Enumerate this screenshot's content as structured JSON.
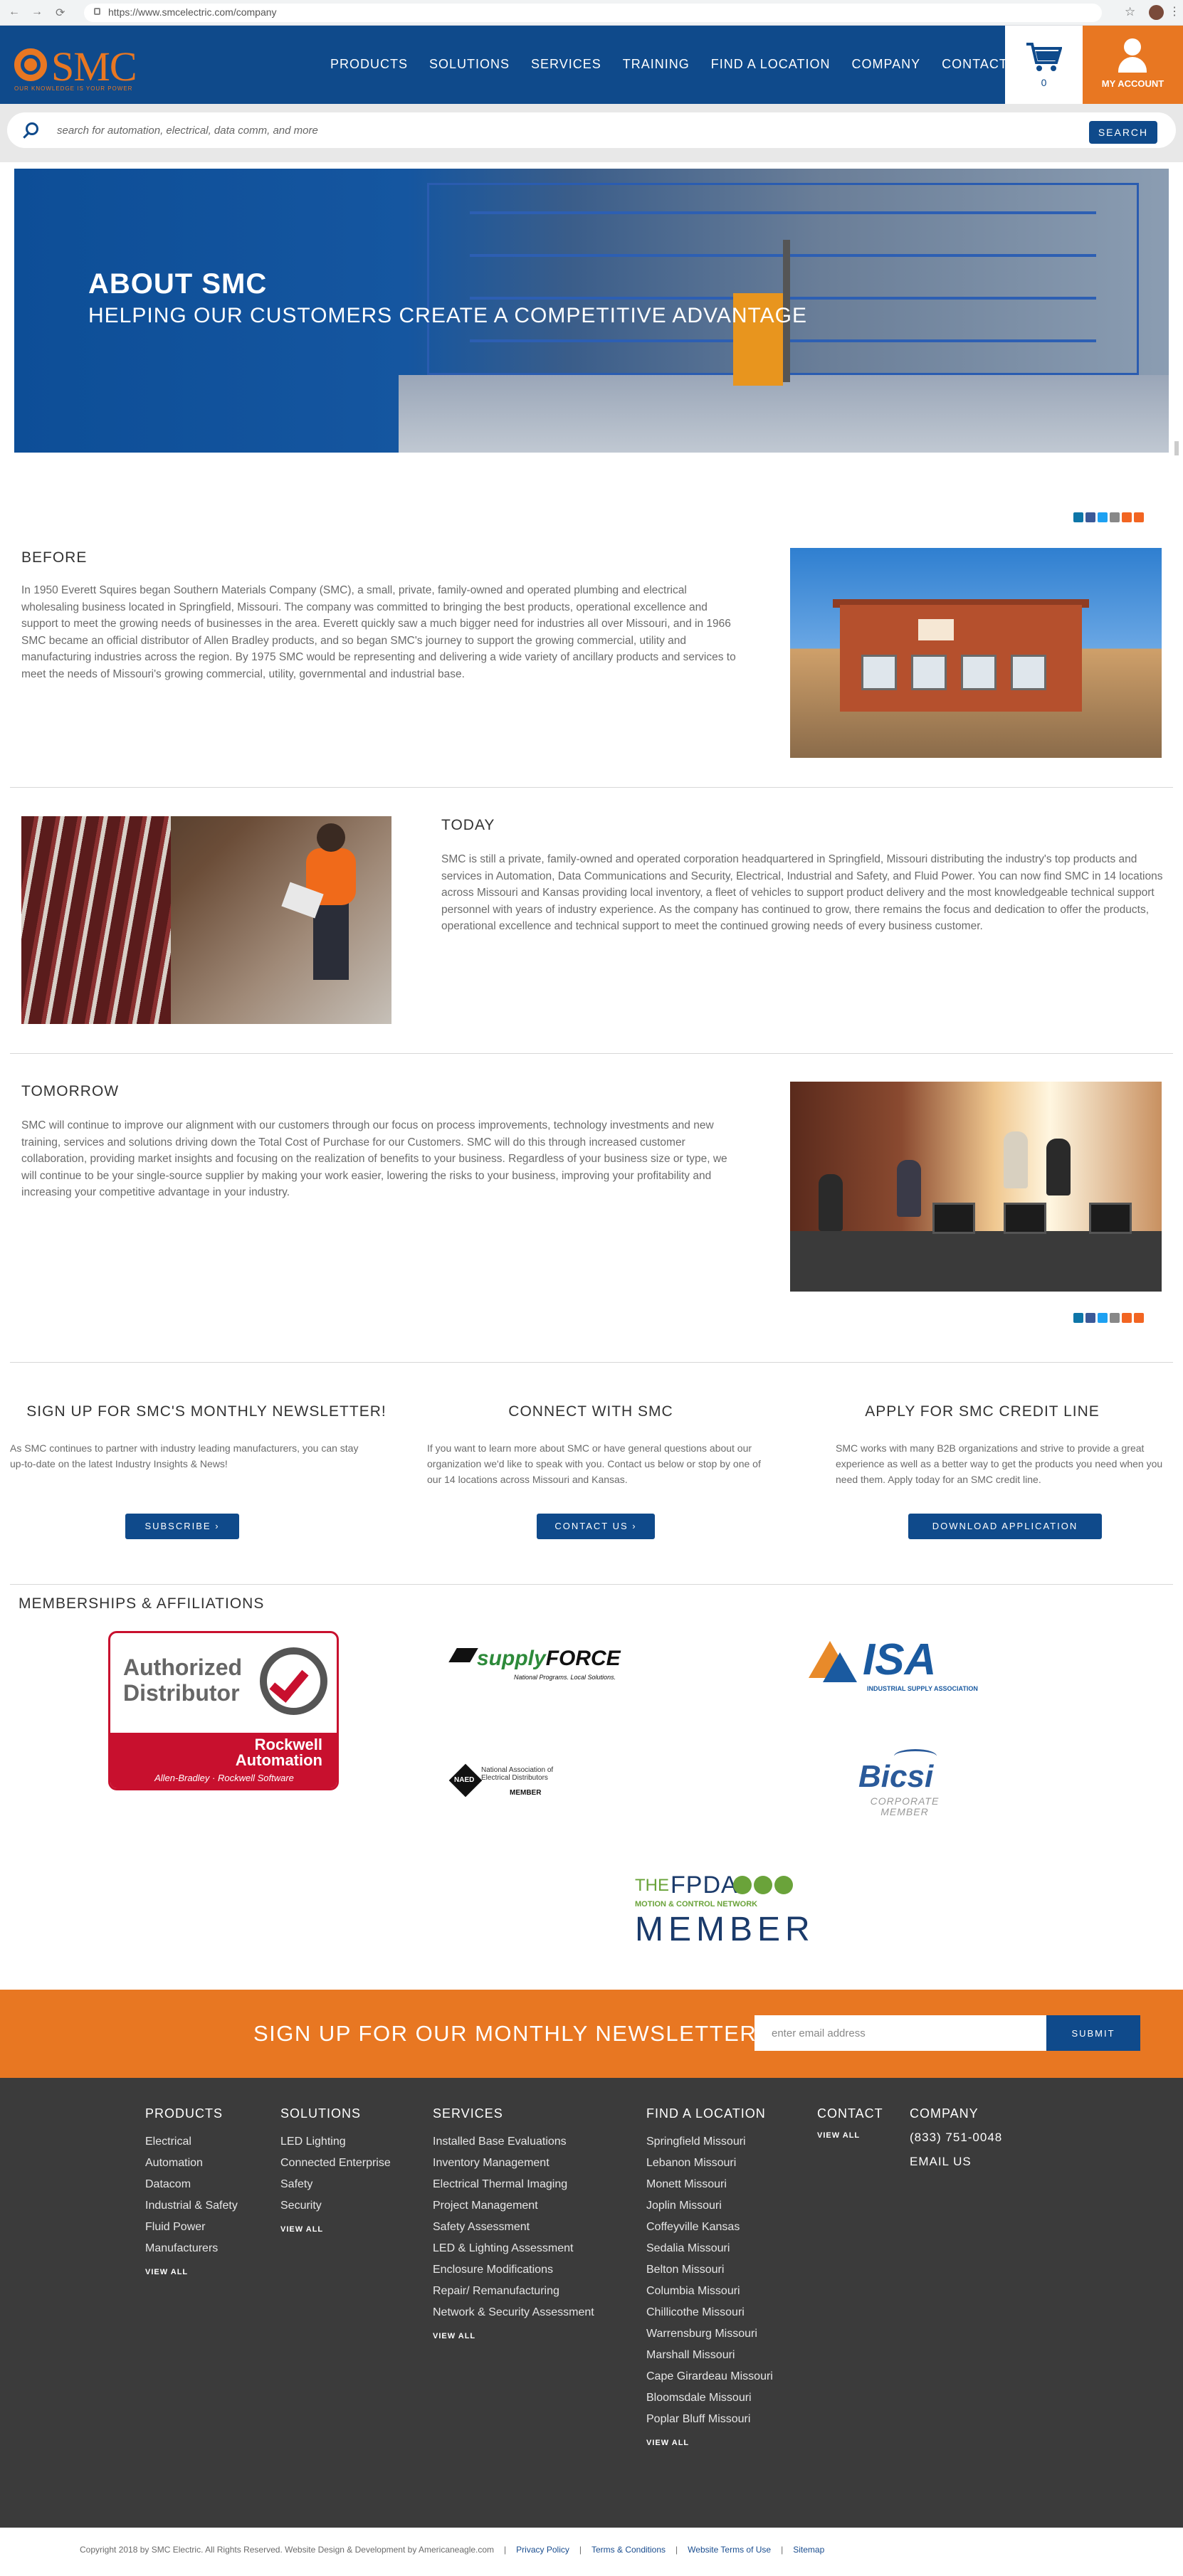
{
  "browser": {
    "url": "https://www.smcelectric.com/company",
    "nav_back": "←",
    "nav_forward": "→",
    "nav_reload": "⟳",
    "star": "☆",
    "menu": "⋮"
  },
  "header": {
    "logo_text": "SMC",
    "logo_tagline": "OUR KNOWLEDGE IS YOUR POWER",
    "nav": [
      "PRODUCTS",
      "SOLUTIONS",
      "SERVICES",
      "TRAINING",
      "FIND A LOCATION",
      "COMPANY",
      "CONTACT"
    ],
    "cart_count": "0",
    "account_label": "MY ACCOUNT",
    "brand_blue": "#0f4a8b",
    "brand_orange": "#e87722"
  },
  "search": {
    "placeholder": "search for automation, electrical, data comm, and more",
    "button": "SEARCH"
  },
  "hero": {
    "title": "ABOUT SMC",
    "subtitle": "HELPING OUR CUSTOMERS CREATE A COMPETITIVE ADVANTAGE"
  },
  "share_icons": [
    "linkedin-icon",
    "facebook-icon",
    "twitter-icon",
    "email-icon",
    "rss-icon",
    "plus-icon"
  ],
  "sections": {
    "before": {
      "title": "BEFORE",
      "text": "In 1950 Everett Squires began Southern Materials Company (SMC), a small, private, family-owned and operated plumbing and electrical wholesaling business located in Springfield, Missouri. The company was committed to bringing the best products, operational excellence and support to meet the growing needs of businesses in the area. Everett quickly saw a much bigger need for industries all over Missouri, and in 1966 SMC became an official distributor of Allen Bradley products, and so began SMC's journey to support the growing commercial, utility and manufacturing industries across the region.  By 1975 SMC would be representing and delivering a wide variety of ancillary products and services to meet the needs of Missouri's growing commercial, utility, governmental and industrial base."
    },
    "today": {
      "title": "TODAY",
      "text": "SMC is still a private, family-owned and operated corporation headquartered in Springfield, Missouri distributing the industry's top products and services in Automation, Data Communications and Security, Electrical, Industrial and Safety, and Fluid Power.  You can now find SMC in 14 locations across Missouri and Kansas providing local inventory, a fleet of vehicles to support product delivery and the most knowledgeable technical support personnel with years of industry experience.  As the company has continued to grow, there remains the focus and dedication to offer the products, operational excellence and technical support to meet the continued growing needs of every business customer."
    },
    "tomorrow": {
      "title": "TOMORROW",
      "text": "SMC will continue to improve our alignment with our customers through our focus on process improvements, technology investments and new training, services and solutions driving down the Total Cost of Purchase for our Customers. SMC will do this through increased customer collaboration, providing market insights and focusing on the realization of benefits to your business.  Regardless of your business size or type, we will continue to be your single-source supplier by making your work easier, lowering the risks to your business, improving your profitability and increasing your competitive advantage in your industry."
    }
  },
  "info_columns": [
    {
      "title": "SIGN UP FOR SMC'S MONTHLY NEWSLETTER!",
      "text": "As SMC continues to partner with industry leading manufacturers, you can stay up-to-date on the latest Industry Insights & News!",
      "button": "SUBSCRIBE ›"
    },
    {
      "title": "CONNECT WITH SMC",
      "text": "If you want to learn more about SMC or have general questions about our organization we'd like to speak with you. Contact us below or stop by one of our 14 locations across Missouri and Kansas.",
      "button": "CONTACT US ›"
    },
    {
      "title": "APPLY FOR SMC CREDIT LINE",
      "text": "SMC works with many B2B organizations and strive to provide a great experience as well as a better way to get the products you need when you need them. Apply today for an SMC credit line.",
      "button": "DOWNLOAD APPLICATION"
    }
  ],
  "memberships": {
    "title": "MEMBERSHIPS & AFFILIATIONS",
    "rockwell": {
      "line1": "Authorized",
      "line2": "Distributor",
      "brand1": "Rockwell",
      "brand2": "Automation",
      "sub": "Allen-Bradley  ·  Rockwell Software"
    },
    "supplyforce": {
      "name_a": "supply",
      "name_b": "FORCE",
      "tagline": "National Programs. Local Solutions."
    },
    "isa": {
      "name": "ISA",
      "sub": "INDUSTRIAL SUPPLY ASSOCIATION"
    },
    "naed": {
      "mark": "NAED",
      "line1": "National Association of",
      "line2": "Electrical Distributors",
      "member": "MEMBER"
    },
    "bicsi": {
      "name": "Bicsi",
      "sub1": "CORPORATE",
      "sub2": "MEMBER"
    },
    "fpda": {
      "the": "THE",
      "name": "FPDA",
      "network": "MOTION & CONTROL NETWORK",
      "member": "MEMBER"
    }
  },
  "newsletter": {
    "title": "SIGN UP FOR OUR MONTHLY NEWSLETTER",
    "placeholder": "enter email address",
    "button": "SUBMIT"
  },
  "footer": {
    "products": {
      "title": "PRODUCTS",
      "items": [
        "Electrical",
        "Automation",
        "Datacom",
        "Industrial & Safety",
        "Fluid Power",
        "Manufacturers"
      ],
      "view_all": "VIEW ALL"
    },
    "solutions": {
      "title": "SOLUTIONS",
      "items": [
        "LED Lighting",
        "Connected Enterprise",
        "Safety",
        "Security"
      ],
      "view_all": "VIEW ALL"
    },
    "services": {
      "title": "SERVICES",
      "items": [
        "Installed Base Evaluations",
        "Inventory Management",
        "Electrical Thermal Imaging",
        "Project Management",
        "Safety Assessment",
        "LED & Lighting Assessment",
        "Enclosure Modifications",
        "Repair/ Remanufacturing",
        "Network & Security Assessment"
      ],
      "view_all": "VIEW ALL"
    },
    "locations": {
      "title": "FIND A LOCATION",
      "items": [
        "Springfield Missouri",
        "Lebanon Missouri",
        "Monett Missouri",
        "Joplin Missouri",
        "Coffeyville Kansas",
        "Sedalia Missouri",
        "Belton Missouri",
        "Columbia Missouri",
        "Chillicothe Missouri",
        "Warrensburg Missouri",
        "Marshall Missouri",
        "Cape Girardeau Missouri",
        "Bloomsdale Missouri",
        "Poplar Bluff Missouri"
      ],
      "view_all": "VIEW ALL"
    },
    "contact": {
      "title": "CONTACT",
      "view_all": "VIEW ALL"
    },
    "company": {
      "title": "COMPANY",
      "phone": "(833) 751-0048",
      "email": "EMAIL US"
    }
  },
  "bottom": {
    "copyright": "Copyright 2018 by SMC Electric. All Rights Reserved. Website Design & Development by Americaneagle.com",
    "sep": "|",
    "links": [
      "Privacy Policy",
      "Terms & Conditions",
      "Website Terms of Use",
      "Sitemap"
    ]
  }
}
